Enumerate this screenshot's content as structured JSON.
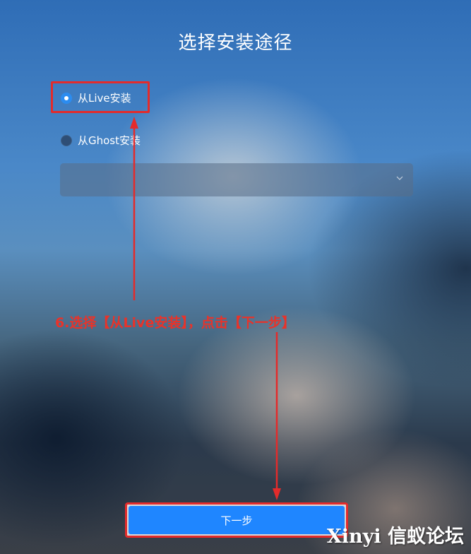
{
  "page": {
    "title": "选择安装途径"
  },
  "options": [
    {
      "label": "从Live安装",
      "selected": true
    },
    {
      "label": "从Ghost安装",
      "selected": false
    }
  ],
  "dropdown": {
    "value": "",
    "icon": "chevron-down-icon"
  },
  "annotation": {
    "text": "6.选择【从Live安装】，点击【下一步】",
    "color": "#e8332a"
  },
  "next_button": {
    "label": "下一步",
    "color": "#1f86ff"
  },
  "watermark": {
    "text": "Xinyi 信蚁论坛"
  }
}
